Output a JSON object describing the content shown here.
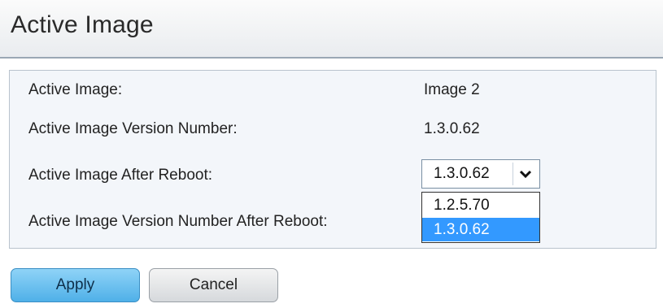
{
  "header": {
    "title": "Active Image"
  },
  "rows": [
    {
      "label": "Active Image:",
      "value": "Image 2"
    },
    {
      "label": "Active Image Version Number:",
      "value": "1.3.0.62"
    },
    {
      "label": "Active Image After Reboot:",
      "value": ""
    },
    {
      "label": "Active Image Version Number After Reboot:",
      "value": ""
    }
  ],
  "reboot_select": {
    "selected": "1.3.0.62",
    "options": [
      "1.2.5.70",
      "1.3.0.62"
    ],
    "highlighted_option": "1.3.0.62",
    "expanded": true
  },
  "buttons": {
    "apply": "Apply",
    "cancel": "Cancel"
  },
  "colors": {
    "highlight": "#3399ff",
    "apply_button": "#4fb0e8",
    "panel_background": "#f3f6fa"
  },
  "icons": {
    "select_arrow": "chevron-down-icon"
  }
}
